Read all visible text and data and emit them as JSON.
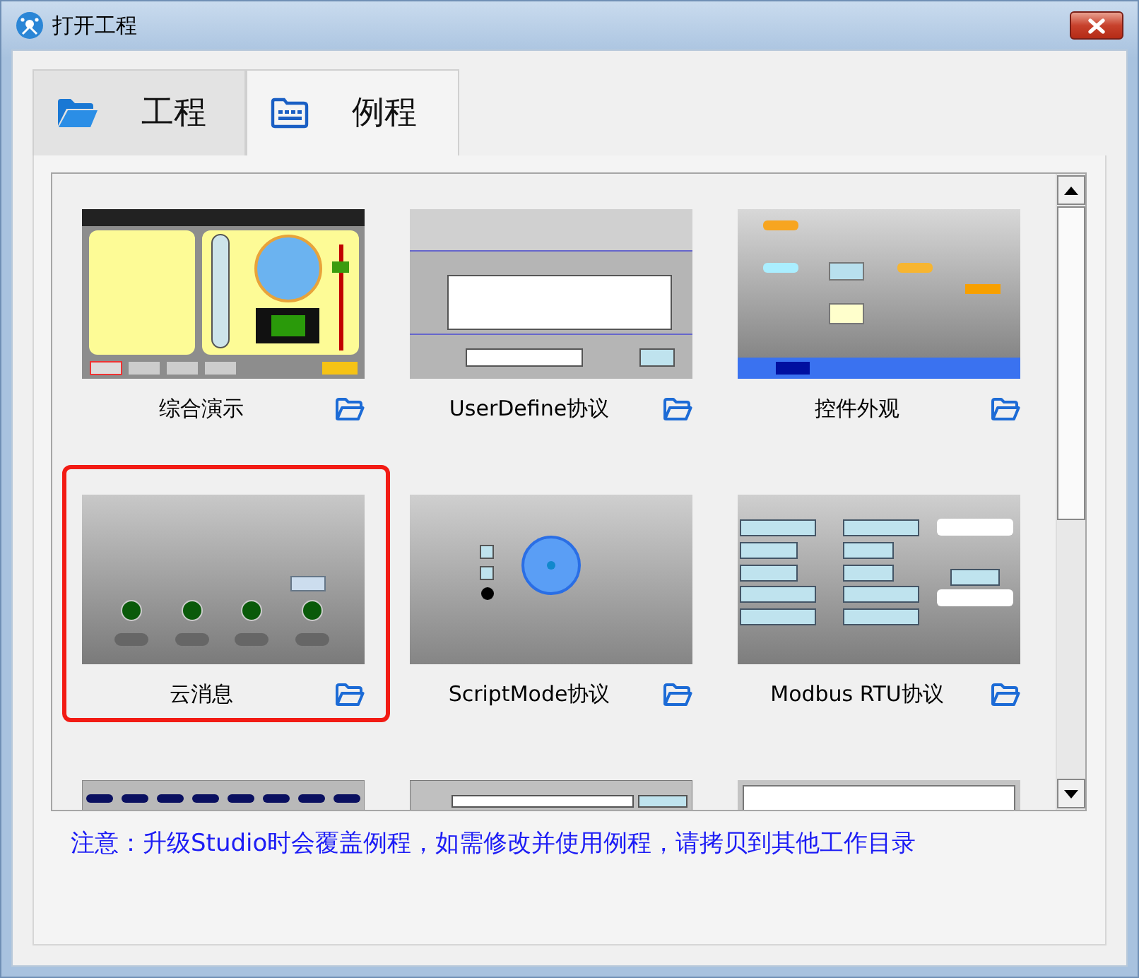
{
  "window": {
    "title": "打开工程"
  },
  "tabs": [
    {
      "label": "工程",
      "selected": false
    },
    {
      "label": "例程",
      "selected": true
    }
  ],
  "examples": [
    {
      "label": "综合演示",
      "selected": false,
      "kind": "dashboard"
    },
    {
      "label": "UserDefine协议",
      "selected": false,
      "kind": "serial"
    },
    {
      "label": "控件外观",
      "selected": false,
      "kind": "controls"
    },
    {
      "label": "云消息",
      "selected": true,
      "kind": "cloud"
    },
    {
      "label": "ScriptMode协议",
      "selected": false,
      "kind": "gauge"
    },
    {
      "label": "Modbus RTU协议",
      "selected": false,
      "kind": "modbus"
    },
    {
      "selected": false,
      "kind": "timers"
    },
    {
      "selected": false,
      "kind": "http"
    },
    {
      "selected": false,
      "kind": "blank"
    }
  ],
  "note": "注意：升级Studio时会覆盖例程，如需修改并使用例程，请拷贝到其他工作目录"
}
